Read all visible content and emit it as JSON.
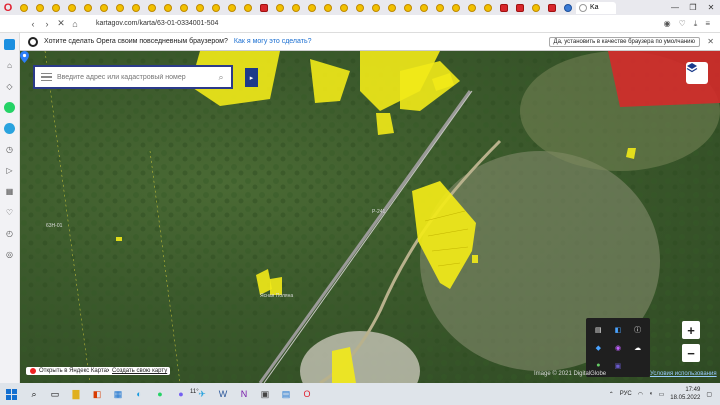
{
  "browser": {
    "tab_active_label": "Ka",
    "url": "kartagov.com/karta/63-01-0334001-504",
    "window_controls": [
      "—",
      "❐",
      "✕"
    ]
  },
  "promo": {
    "text": "Хотите сделать Opera своим повседневным браузером?",
    "link": "Как я могу это сделать?",
    "button": "Да, установить в качестве браузера по умолчанию"
  },
  "search": {
    "placeholder": "Введите адрес или кадастровый номер"
  },
  "map": {
    "labels": {
      "road": "Р-241",
      "settlement": "Ясная Поляна",
      "left_road": "63Н-01"
    },
    "attribution": "Image © 2021 DigitalGlobe",
    "terms": "Условия использования",
    "open_yandex": "Открыть в Яндекс Картах",
    "create_map": "Создать свою карту"
  },
  "taskbar": {
    "weather": "11°",
    "lang": "РУС",
    "time": "17:49",
    "date": "18.05.2022"
  },
  "colors": {
    "parcel_yellow": "#f2ea18",
    "parcel_red": "#d42a2a",
    "search_border": "#2b3a8a"
  }
}
